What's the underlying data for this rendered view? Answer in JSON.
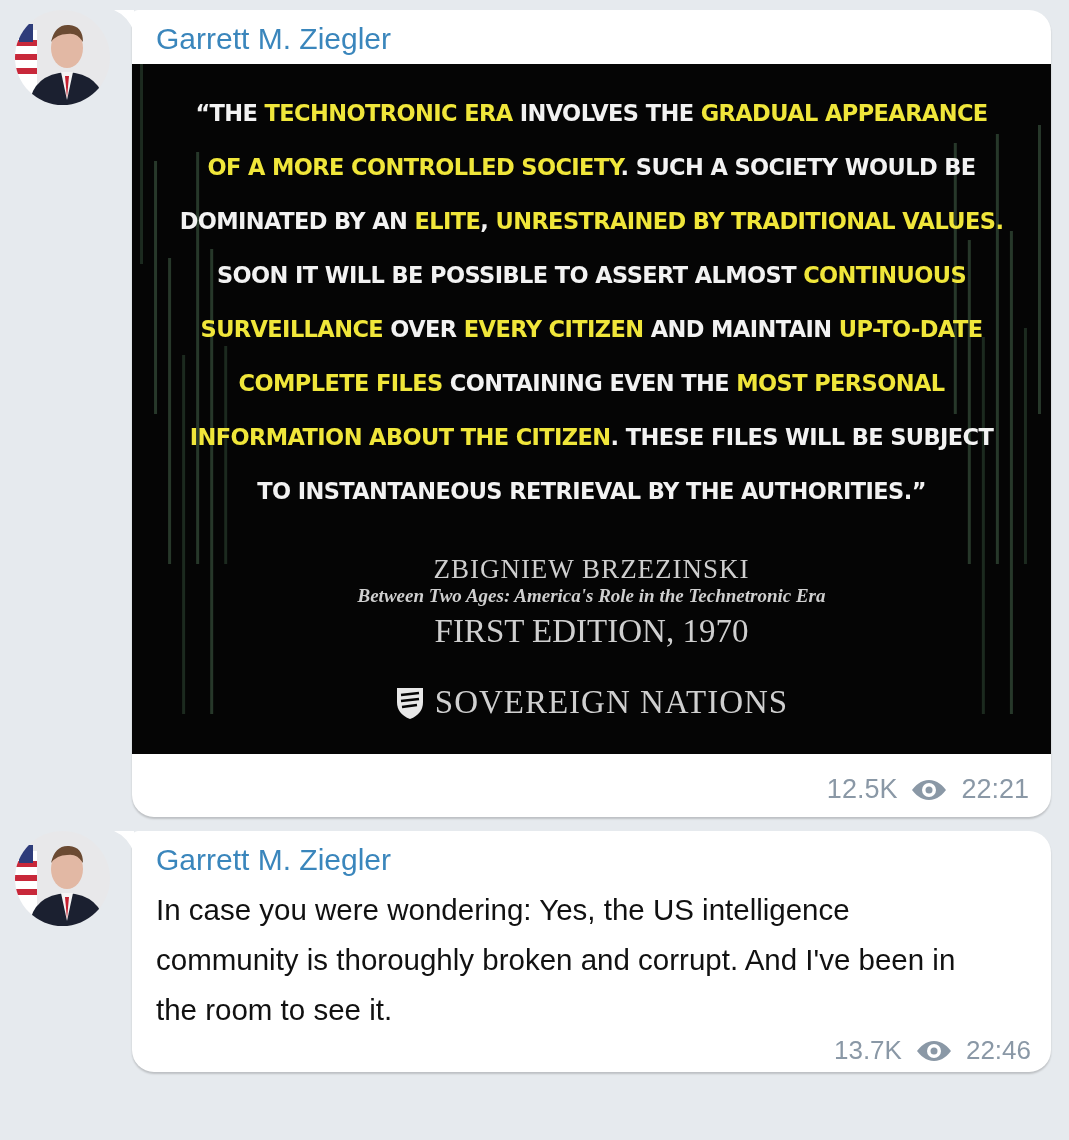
{
  "messages": [
    {
      "author": "Garrett M. Ziegler",
      "media": {
        "quote": [
          [
            {
              "text": "“THE ",
              "highlight": false
            },
            {
              "text": "TECHNOTRONIC ERA",
              "highlight": true
            },
            {
              "text": " INVOLVES THE ",
              "highlight": false
            },
            {
              "text": "GRADUAL APPEARANCE",
              "highlight": true
            }
          ],
          [
            {
              "text": "OF A MORE CONTROLLED SOCIETY",
              "highlight": true
            },
            {
              "text": ". SUCH A SOCIETY WOULD BE",
              "highlight": false
            }
          ],
          [
            {
              "text": "DOMINATED BY AN ",
              "highlight": false
            },
            {
              "text": "ELITE",
              "highlight": true
            },
            {
              "text": ", ",
              "highlight": false
            },
            {
              "text": "UNRESTRAINED BY TRADITIONAL VALUES.",
              "highlight": true
            }
          ],
          [
            {
              "text": "SOON IT WILL BE POSSIBLE TO ASSERT ALMOST ",
              "highlight": false
            },
            {
              "text": "CONTINUOUS",
              "highlight": true
            }
          ],
          [
            {
              "text": "SURVEILLANCE",
              "highlight": true
            },
            {
              "text": " OVER ",
              "highlight": false
            },
            {
              "text": "EVERY CITIZEN",
              "highlight": true
            },
            {
              "text": " AND MAINTAIN ",
              "highlight": false
            },
            {
              "text": "UP-TO-DATE",
              "highlight": true
            }
          ],
          [
            {
              "text": "COMPLETE FILES",
              "highlight": true
            },
            {
              "text": " CONTAINING EVEN THE ",
              "highlight": false
            },
            {
              "text": "MOST PERSONAL",
              "highlight": true
            }
          ],
          [
            {
              "text": "INFORMATION ABOUT THE CITIZEN",
              "highlight": true
            },
            {
              "text": ". THESE FILES WILL BE SUBJECT",
              "highlight": false
            }
          ],
          [
            {
              "text": "TO INSTANTANEOUS RETRIEVAL BY THE AUTHORITIES.”",
              "highlight": false
            }
          ]
        ],
        "author": "ZBIGNIEW BRZEZINSKI",
        "book": "Between Two Ages: America's Role in the Technetronic Era",
        "edition": "FIRST EDITION, 1970",
        "publisher": "SOVEREIGN NATIONS"
      },
      "views": "12.5K",
      "time": "22:21"
    },
    {
      "author": "Garrett M. Ziegler",
      "text": "In case you were wondering: Yes, the US intelligence community is thoroughly broken and corrupt. And I've been in the room to see it.",
      "views": "13.7K",
      "time": "22:46"
    }
  ]
}
